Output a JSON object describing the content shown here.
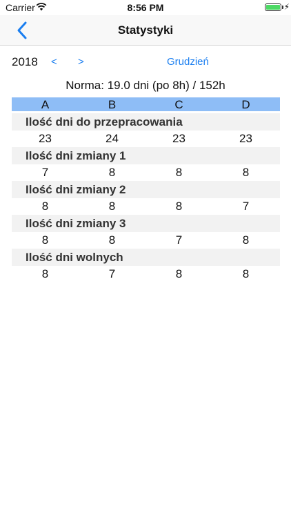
{
  "status_bar": {
    "carrier": "Carrier",
    "time": "8:56 PM",
    "battery_icon": "battery-icon",
    "wifi_icon": "wifi-icon"
  },
  "nav": {
    "title": "Statystyki",
    "back_icon": "chevron-left-icon"
  },
  "period": {
    "year": "2018",
    "prev_label": "<",
    "next_label": ">",
    "month": "Grudzień"
  },
  "norma": "Norma: 19.0 dni (po 8h) / 152h",
  "columns": [
    "A",
    "B",
    "C",
    "D"
  ],
  "sections": [
    {
      "label": "Ilość dni do przepracowania",
      "values": [
        "23",
        "24",
        "23",
        "23"
      ]
    },
    {
      "label": "Ilość dni zmiany 1",
      "values": [
        "7",
        "8",
        "8",
        "8"
      ]
    },
    {
      "label": "Ilość dni zmiany 2",
      "values": [
        "8",
        "8",
        "8",
        "7"
      ]
    },
    {
      "label": "Ilość dni zmiany 3",
      "values": [
        "8",
        "8",
        "7",
        "8"
      ]
    },
    {
      "label": "Ilość dni wolnych",
      "values": [
        "8",
        "7",
        "8",
        "8"
      ]
    }
  ],
  "colors": {
    "accent": "#1a7ef0",
    "header_bg": "#8ebdf6",
    "label_bg": "#f2f2f2",
    "battery": "#4cd964"
  }
}
